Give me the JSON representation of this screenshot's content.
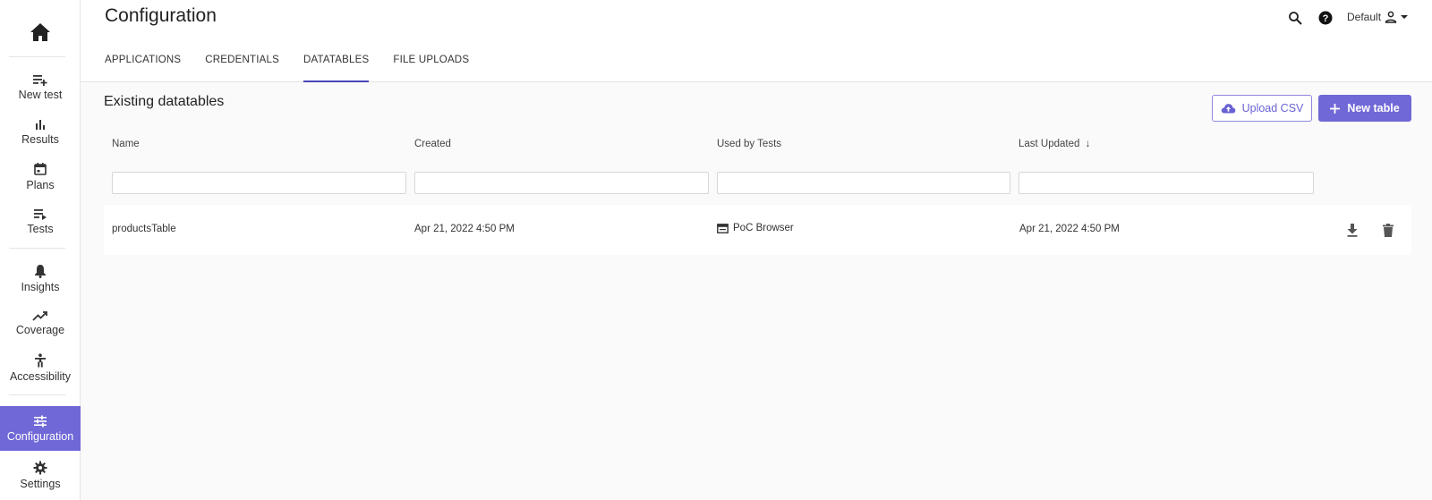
{
  "sidebar": {
    "items": [
      {
        "label": "New test",
        "icon": "playlist-add-icon"
      },
      {
        "label": "Results",
        "icon": "bar-chart-icon"
      },
      {
        "label": "Plans",
        "icon": "calendar-icon"
      },
      {
        "label": "Tests",
        "icon": "playlist-play-icon"
      },
      {
        "label": "Insights",
        "icon": "bell-icon"
      },
      {
        "label": "Coverage",
        "icon": "trending-up-icon"
      },
      {
        "label": "Accessibility",
        "icon": "accessibility-icon"
      },
      {
        "label": "Configuration",
        "icon": "tune-icon"
      },
      {
        "label": "Settings",
        "icon": "gear-icon"
      }
    ],
    "active": "Configuration",
    "accent": "#7068d6"
  },
  "header": {
    "title": "Configuration",
    "profile_label": "Default",
    "tabs": [
      {
        "label": "APPLICATIONS"
      },
      {
        "label": "CREDENTIALS"
      },
      {
        "label": "DATATABLES"
      },
      {
        "label": "FILE UPLOADS"
      }
    ],
    "active_tab": "DATATABLES"
  },
  "main": {
    "section_title": "Existing datatables",
    "upload_label": "Upload CSV",
    "new_table_label": "New table",
    "columns": [
      "Name",
      "Created",
      "Used by Tests",
      "Last Updated"
    ],
    "sort_indicator": "↓",
    "filters": [
      "",
      "",
      "",
      ""
    ],
    "rows": [
      {
        "name": "productsTable",
        "created": "Apr 21, 2022 4:50 PM",
        "used_by": "PoC Browser",
        "last_updated": "Apr 21, 2022 4:50 PM"
      }
    ]
  }
}
